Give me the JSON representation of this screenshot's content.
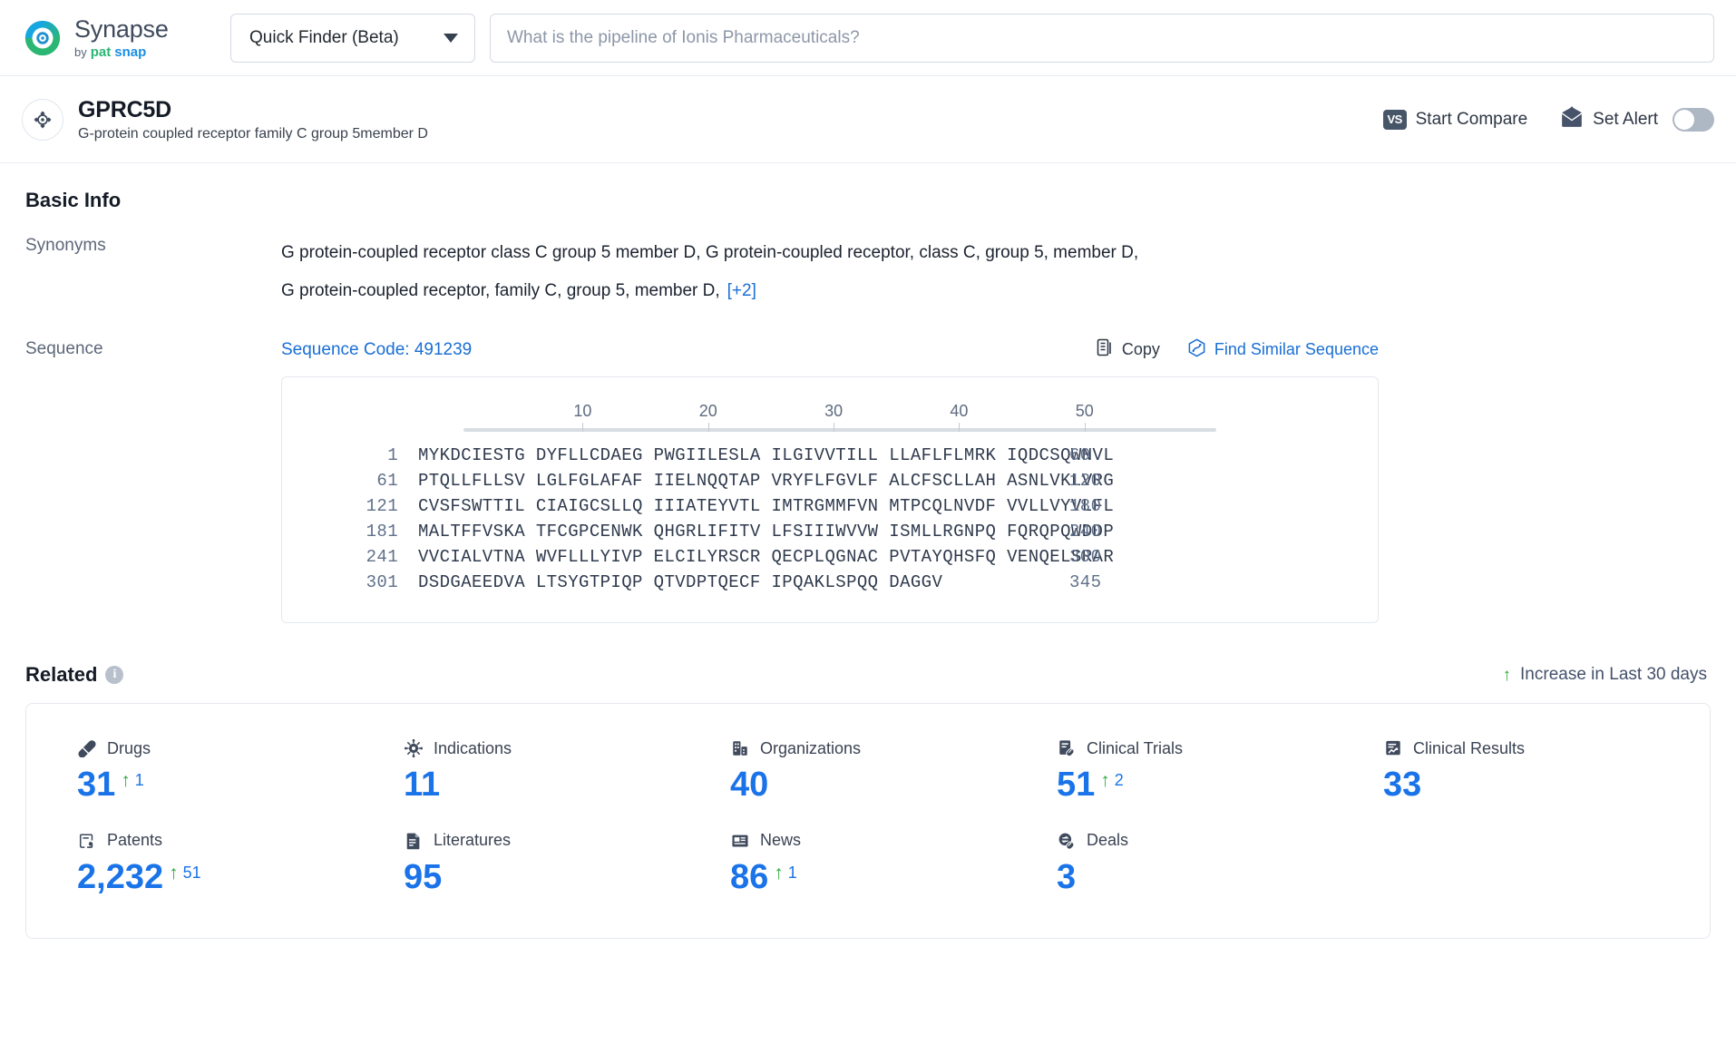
{
  "topbar": {
    "brand_name": "Synapse",
    "brand_by": "by",
    "brand_pat": "pat",
    "brand_snap": "snap",
    "finder_label": "Quick Finder (Beta)",
    "search_value": "",
    "search_placeholder": "What is the pipeline of Ionis Pharmaceuticals?"
  },
  "entity": {
    "title": "GPRC5D",
    "subtitle": "G-protein coupled receptor family C group 5member D",
    "compare_label": "Start Compare",
    "compare_badge": "VS",
    "alert_label": "Set Alert",
    "alert_toggle_state": "off"
  },
  "basic_info": {
    "section_title": "Basic Info",
    "synonyms_label": "Synonyms",
    "synonyms_line1": "G protein-coupled receptor class C group 5 member D,  G protein-coupled receptor, class C, group 5, member D,",
    "synonyms_line2": "G protein-coupled receptor, family C, group 5, member D,",
    "synonyms_more": "[+2]",
    "sequence_label": "Sequence",
    "sequence_code": "Sequence Code: 491239",
    "copy_label": "Copy",
    "find_similar_label": "Find Similar Sequence"
  },
  "sequence": {
    "ruler_ticks": [
      10,
      20,
      30,
      40,
      50
    ],
    "rows": [
      {
        "start": "1",
        "chunks": "MYKDCIESTG DYFLLCDAEG PWGIILESLA ILGIVVTILL LLAFLFLMRK IQDCSQWNVL",
        "end": "60"
      },
      {
        "start": "61",
        "chunks": "PTQLLFLLSV LGLFGLAFAF IIELNQQTAP VRYFLFGVLF ALCFSCLLAH ASNLVKLVRG",
        "end": "120"
      },
      {
        "start": "121",
        "chunks": "CVSFSWTTIL CIAIGCSLLQ IIIATEYVTL IMTRGMMFVN MTPCQLNVDF VVLLVYVLFL",
        "end": "180"
      },
      {
        "start": "181",
        "chunks": "MALTFFVSKA TFCGPCENWK QHGRLIFITV LFSIIIWVVW ISMLLRGNPQ FQRQPQWDDP",
        "end": "240"
      },
      {
        "start": "241",
        "chunks": "VVCIALVTNA WVFLLLYIVP ELCILYRSCR QECPLQGNAC PVTAYQHSFQ VENQELSRAR",
        "end": "300"
      },
      {
        "start": "301",
        "chunks": "DSDGAEEDVA LTSYGTPIQP QTVDPTQECF IPQAKLSPQQ DAGGV",
        "end": "345"
      }
    ]
  },
  "related": {
    "title": "Related",
    "info_glyph": "i",
    "legend_label": "Increase in Last 30 days",
    "legend_arrow": "↑",
    "stats": [
      {
        "icon": "pill-icon",
        "label": "Drugs",
        "value": "31",
        "delta": "1"
      },
      {
        "icon": "virus-icon",
        "label": "Indications",
        "value": "11",
        "delta": ""
      },
      {
        "icon": "building-icon",
        "label": "Organizations",
        "value": "40",
        "delta": ""
      },
      {
        "icon": "clinical-trial-icon",
        "label": "Clinical Trials",
        "value": "51",
        "delta": "2"
      },
      {
        "icon": "clinical-result-icon",
        "label": "Clinical Results",
        "value": "33",
        "delta": ""
      },
      {
        "icon": "patent-icon",
        "label": "Patents",
        "value": "2,232",
        "delta": "51"
      },
      {
        "icon": "literature-icon",
        "label": "Literatures",
        "value": "95",
        "delta": ""
      },
      {
        "icon": "news-icon",
        "label": "News",
        "value": "86",
        "delta": "1"
      },
      {
        "icon": "deals-icon",
        "label": "Deals",
        "value": "3",
        "delta": ""
      }
    ]
  },
  "colors": {
    "accent_blue": "#1a73e8",
    "link_blue": "#1a6fd4",
    "increase_green": "#2eab3c",
    "icon_slate": "#3f4a5c",
    "border": "#e4e8ee"
  }
}
